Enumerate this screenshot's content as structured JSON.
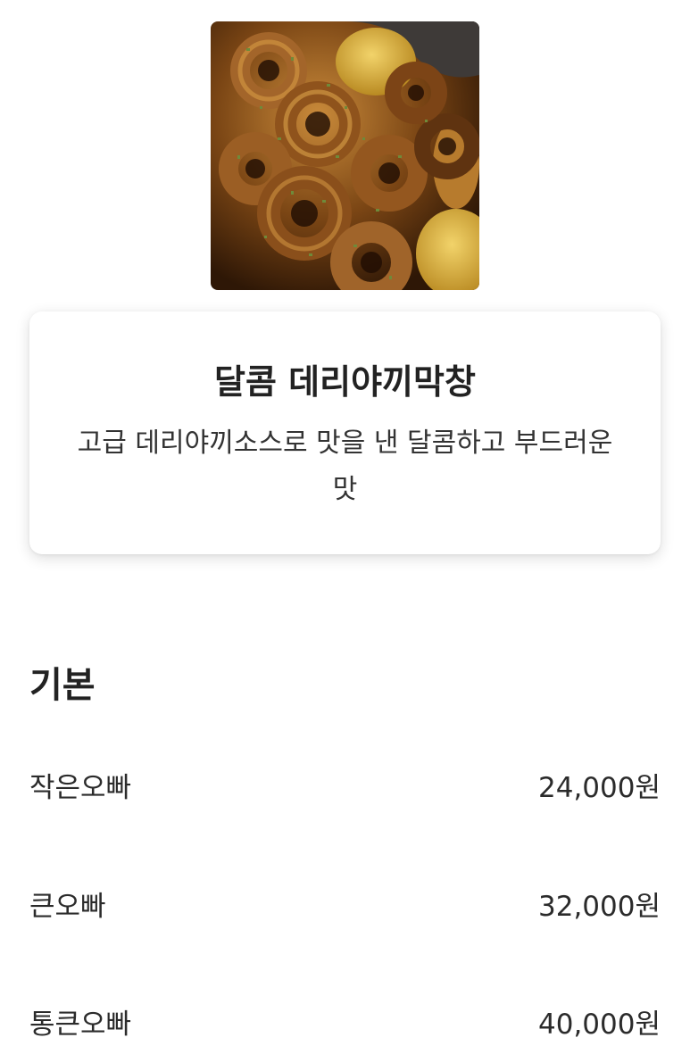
{
  "menu_item": {
    "title": "달콤 데리야끼막창",
    "description": "고급 데리야끼소스로 맛을 낸 달콤하고 부드러운 맛"
  },
  "section": {
    "heading": "기본"
  },
  "options": [
    {
      "name": "작은오빠",
      "price": "24,000원"
    },
    {
      "name": "큰오빠",
      "price": "32,000원"
    },
    {
      "name": "통큰오빠",
      "price": "40,000원"
    }
  ],
  "colors": {
    "text_primary": "#222222",
    "text_secondary": "#333333",
    "card_background": "#ffffff"
  }
}
